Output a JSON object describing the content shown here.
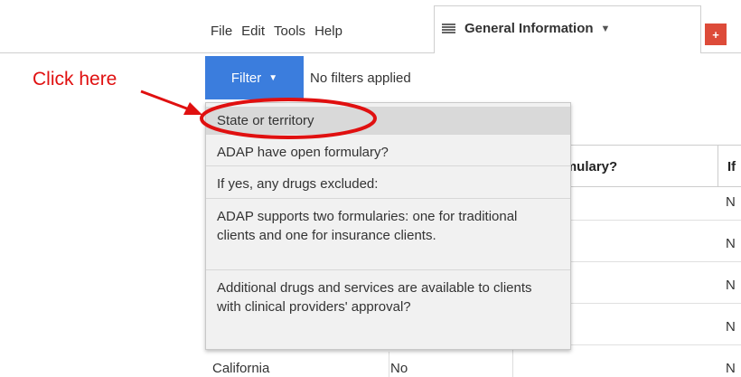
{
  "annotation": {
    "text": "Click here"
  },
  "menu": [
    "File",
    "Edit",
    "Tools",
    "Help"
  ],
  "tab": {
    "label": "General Information",
    "add_label": "+"
  },
  "filter": {
    "button_label": "Filter",
    "status": "No filters applied"
  },
  "dropdown": {
    "items": [
      "State or territory",
      "ADAP have open formulary?",
      "If yes, any drugs excluded:",
      "ADAP supports two formularies: one for traditional clients and one for insurance clients.",
      "Additional drugs and services are available to clients with clinical providers' approval?"
    ]
  },
  "table": {
    "headers": [
      "rmulary?",
      "If"
    ],
    "rows": [
      {
        "state": "",
        "formulary": "",
        "if": "N"
      },
      {
        "state": "",
        "formulary": "",
        "if": "N"
      },
      {
        "state": "",
        "formulary": "",
        "if": "N"
      },
      {
        "state": "",
        "formulary": "",
        "if": "N"
      },
      {
        "state": "California",
        "formulary": "No",
        "if": "N"
      }
    ]
  },
  "colors": {
    "accent": "#3b7ddd",
    "annotation": "#e01010",
    "add_tab": "#dd4b39"
  }
}
